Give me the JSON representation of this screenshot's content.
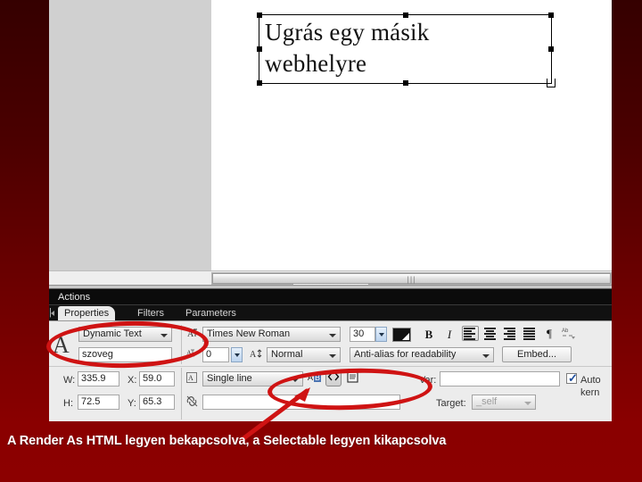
{
  "slide": {
    "caption": "A Render As HTML legyen bekapcsolva, a Selectable legyen kikapcsolva",
    "background_top_color": "#350000",
    "background_bottom_color": "#8c0000",
    "annotation_color": "#cf1313"
  },
  "canvas": {
    "text_object": {
      "content": "Ugrás egy másik\nwebhelyre",
      "selected": true
    }
  },
  "panels": {
    "actions_title": "Actions",
    "tabs": [
      {
        "label": "Properties",
        "active": true
      },
      {
        "label": "Filters",
        "active": false
      },
      {
        "label": "Parameters",
        "active": false
      }
    ],
    "tab_separator": "|"
  },
  "properties": {
    "type_glyph": "A",
    "text_type": "Dynamic Text",
    "instance_name": "szoveg",
    "font_family": "Times New Roman",
    "font_size": "30",
    "letter_spacing": "0",
    "character_position": "Normal",
    "anti_alias": "Anti-alias for readability",
    "embed_button": "Embed...",
    "bold_label": "B",
    "italic_label": "I",
    "paragraph_label": "¶",
    "dimensions": {
      "w_label": "W:",
      "w_value": "335.9",
      "h_label": "H:",
      "h_value": "72.5",
      "x_label": "X:",
      "x_value": "59.0",
      "y_label": "Y:",
      "y_value": "65.3"
    },
    "line_type": "Single line",
    "selectable_label": "AB",
    "render_as_html_label": "<>",
    "show_border_label": "▤",
    "var_label": "Var:",
    "var_value": "",
    "auto_kern_label": "Auto kern",
    "auto_kern_checked": true,
    "link_value": "",
    "target_label": "Target:",
    "target_value": "_self"
  }
}
